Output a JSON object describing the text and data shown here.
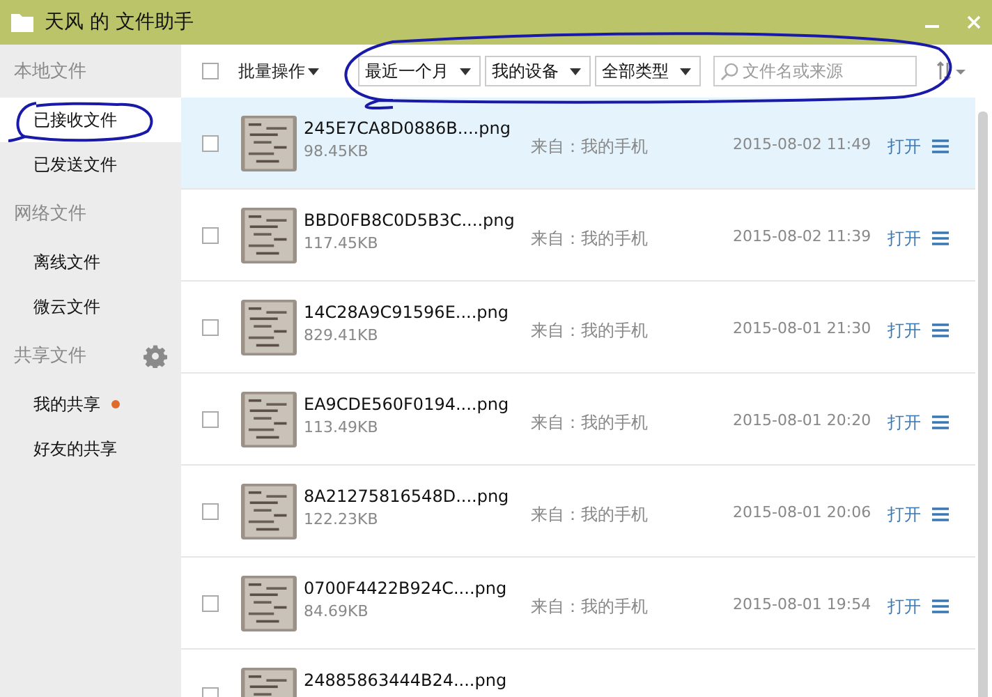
{
  "window": {
    "title": "天风 的 文件助手"
  },
  "sidebar": {
    "sections": [
      {
        "title": "本地文件",
        "settings": false,
        "items": [
          {
            "label": "已接收文件",
            "selected": true,
            "badge": false
          },
          {
            "label": "已发送文件",
            "selected": false,
            "badge": false
          }
        ]
      },
      {
        "title": "网络文件",
        "settings": false,
        "items": [
          {
            "label": "离线文件",
            "selected": false,
            "badge": false
          },
          {
            "label": "微云文件",
            "selected": false,
            "badge": false
          }
        ]
      },
      {
        "title": "共享文件",
        "settings": true,
        "items": [
          {
            "label": "我的共享",
            "selected": false,
            "badge": true
          },
          {
            "label": "好友的共享",
            "selected": false,
            "badge": false
          }
        ]
      }
    ]
  },
  "toolbar": {
    "select_all": {
      "checked": false
    },
    "batch_label": "批量操作",
    "filters": [
      "最近一个月",
      "我的设备",
      "全部类型"
    ],
    "search": {
      "placeholder": "文件名或来源"
    }
  },
  "files": [
    {
      "name": "245E7CA8D0886B....png",
      "size": "98.45KB",
      "source": "来自：我的手机",
      "time": "2015-08-02 11:49",
      "action": "打开",
      "selected": true,
      "checked": false
    },
    {
      "name": "BBD0FB8C0D5B3C....png",
      "size": "117.45KB",
      "source": "来自：我的手机",
      "time": "2015-08-02 11:39",
      "action": "打开",
      "selected": false,
      "checked": false
    },
    {
      "name": "14C28A9C91596E....png",
      "size": "829.41KB",
      "source": "来自：我的手机",
      "time": "2015-08-01 21:30",
      "action": "打开",
      "selected": false,
      "checked": false
    },
    {
      "name": "EA9CDE560F0194....png",
      "size": "113.49KB",
      "source": "来自：我的手机",
      "time": "2015-08-01 20:20",
      "action": "打开",
      "selected": false,
      "checked": false
    },
    {
      "name": "8A21275816548D....png",
      "size": "122.23KB",
      "source": "来自：我的手机",
      "time": "2015-08-01 20:06",
      "action": "打开",
      "selected": false,
      "checked": false
    },
    {
      "name": "0700F4422B924C....png",
      "size": "84.69KB",
      "source": "来自：我的手机",
      "time": "2015-08-01 19:54",
      "action": "打开",
      "selected": false,
      "checked": false
    },
    {
      "name": "24885863444B24....png",
      "selected": false,
      "checked": false
    }
  ]
}
